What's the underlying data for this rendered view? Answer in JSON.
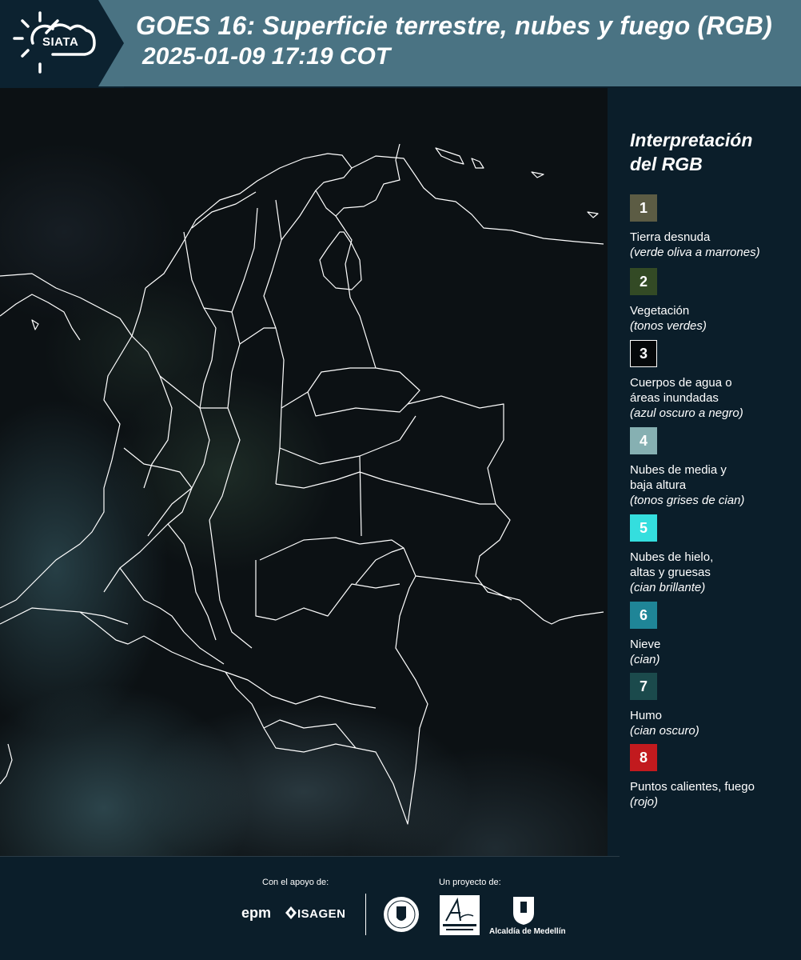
{
  "header": {
    "logo_text": "SIATA",
    "title_line1": "GOES 16: Superficie terrestre, nubes y fuego (RGB)",
    "title_line2": "2025-01-09 17:19 COT"
  },
  "legend": {
    "title_line1": "Interpretación",
    "title_line2": "del RGB",
    "items": [
      {
        "num": "1",
        "color": "#5c5c44",
        "label": "Tierra desnuda",
        "sub": "(verde oliva a marrones)"
      },
      {
        "num": "2",
        "color": "#334a25",
        "label": "Vegetación",
        "sub": "(tonos verdes)"
      },
      {
        "num": "3",
        "color": "#05080a",
        "label": "Cuerpos de agua o áreas inundadas",
        "sub": "(azul oscuro a negro)"
      },
      {
        "num": "4",
        "color": "#86b0b2",
        "label": "Nubes de media y baja altura",
        "sub": "(tonos grises de cian)"
      },
      {
        "num": "5",
        "color": "#34dede",
        "label": "Nubes de hielo, altas y gruesas",
        "sub": "(cian brillante)"
      },
      {
        "num": "6",
        "color": "#1f8597",
        "label": "Nieve",
        "sub": "(cian)"
      },
      {
        "num": "7",
        "color": "#1b4a4c",
        "label": "Humo",
        "sub": "(cian oscuro)"
      },
      {
        "num": "8",
        "color": "#c21a1e",
        "label": "Puntos calientes, fuego",
        "sub": "(rojo)"
      }
    ]
  },
  "footer": {
    "support_label": "Con el apoyo de:",
    "project_label": "Un proyecto de:",
    "sponsor1": "epm",
    "sponsor2": "ISAGEN",
    "partner_alcaldia": "Alcaldía de Medellín"
  }
}
